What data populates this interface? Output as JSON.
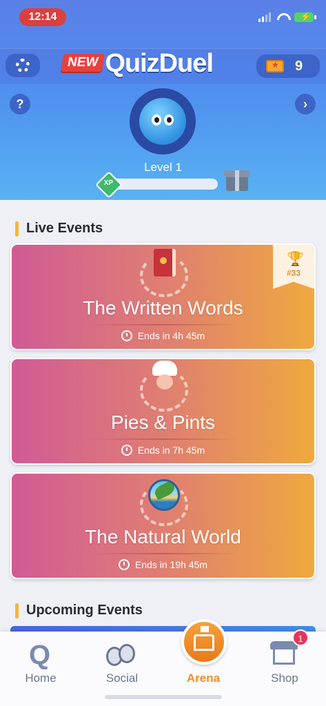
{
  "status_bar": {
    "time": "12:14"
  },
  "header": {
    "logo_new": "NEW",
    "logo_text": "QuizDuel",
    "tickets": "9",
    "help": "?",
    "next": "›"
  },
  "profile": {
    "level": "Level 1",
    "xp_badge": "XP",
    "xp_progress": 0
  },
  "live_events": {
    "title": "Live Events",
    "items": [
      {
        "title": "The Written Words",
        "time": "Ends in 4h 45m",
        "rank": "#33",
        "icon": "book-icon"
      },
      {
        "title": "Pies & Pints",
        "time": "Ends in 7h 45m",
        "icon": "chef-icon"
      },
      {
        "title": "The Natural World",
        "time": "Ends in 19h 45m",
        "icon": "globe-leaf-icon"
      }
    ]
  },
  "upcoming": {
    "title": "Upcoming Events"
  },
  "nav": {
    "items": [
      {
        "label": "Home",
        "icon": "q-icon"
      },
      {
        "label": "Social",
        "icon": "people-icon"
      },
      {
        "label": "Arena",
        "icon": "arena-icon",
        "active": true
      },
      {
        "label": "Shop",
        "icon": "shop-icon",
        "badge": "1"
      }
    ],
    "active_color": "#ee8f2c",
    "inactive_color": "#6a7590"
  }
}
